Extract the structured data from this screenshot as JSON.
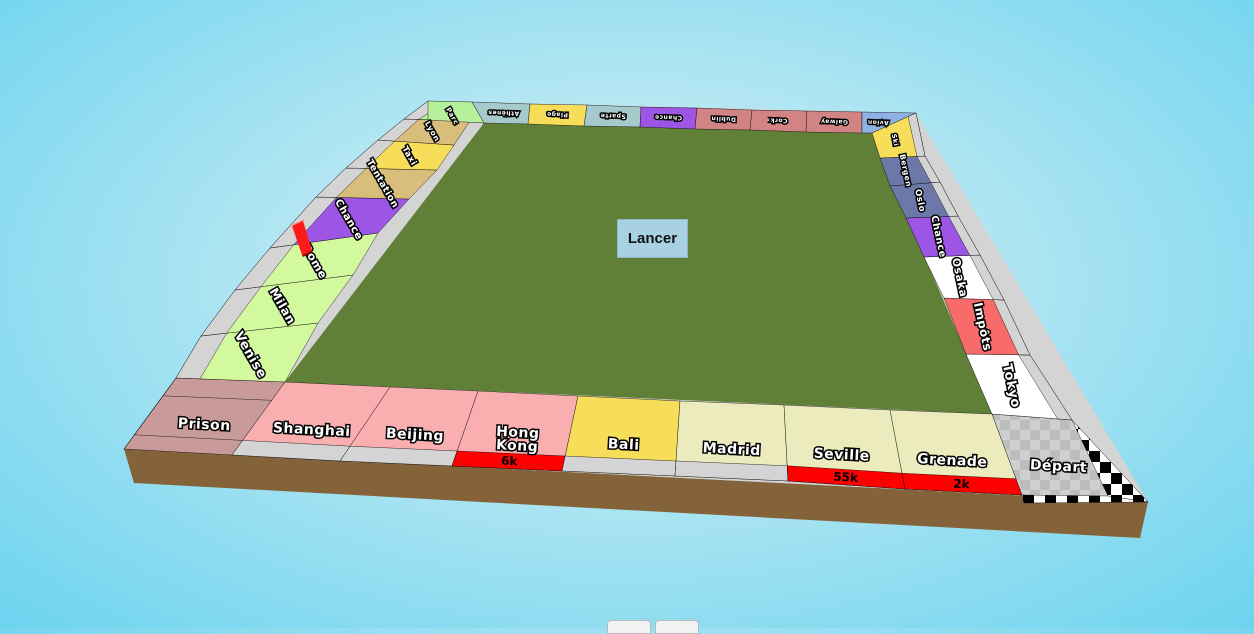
{
  "actions": {
    "roll_label": "Lancer"
  },
  "board": {
    "bottom_row": [
      {
        "name": "Prison",
        "color": "#c89a9a",
        "price": ""
      },
      {
        "name": "Shanghai",
        "color": "#f9afaf",
        "price": ""
      },
      {
        "name": "Beijing",
        "color": "#f9afaf",
        "price": ""
      },
      {
        "name": "Hong\nKong",
        "color": "#f9afaf",
        "price": "6k"
      },
      {
        "name": "Bali",
        "color": "#f6de5a",
        "price": ""
      },
      {
        "name": "Madrid",
        "color": "#ecebbd",
        "price": ""
      },
      {
        "name": "Seville",
        "color": "#ecebbd",
        "price": "55k"
      },
      {
        "name": "Grenade",
        "color": "#ecebbd",
        "price": "2k"
      },
      {
        "name": "Départ",
        "color": "#d0d0d0",
        "price": ""
      }
    ],
    "left_column": [
      {
        "name": "Venise",
        "color": "#d3f99f"
      },
      {
        "name": "Milan",
        "color": "#d3f99f"
      },
      {
        "name": "Rome",
        "color": "#d3f99f"
      },
      {
        "name": "Chance",
        "color": "#9d55e6"
      },
      {
        "name": "Tentation",
        "color": "#d9bd7a"
      },
      {
        "name": "Taxi",
        "color": "#f6de5a"
      },
      {
        "name": "Lyon",
        "color": "#d9bd7a"
      },
      {
        "name": "Parc",
        "color": "#b7f09a"
      }
    ],
    "top_row": [
      {
        "name": "Athènes",
        "color": "#a6c9cb"
      },
      {
        "name": "Plage",
        "color": "#f6de5a"
      },
      {
        "name": "Sparte",
        "color": "#a6c9cb"
      },
      {
        "name": "Chance",
        "color": "#9d55e6"
      },
      {
        "name": "Dublin",
        "color": "#d28484"
      },
      {
        "name": "Cork",
        "color": "#d28484"
      },
      {
        "name": "Galway",
        "color": "#d28484"
      },
      {
        "name": "Avion",
        "color": "#8eb1e6"
      }
    ],
    "right_column": [
      {
        "name": "Tokyo",
        "color": "#ffffff"
      },
      {
        "name": "Impôts",
        "color": "#f76b6b"
      },
      {
        "name": "Osaka",
        "color": "#ffffff"
      },
      {
        "name": "Chance",
        "color": "#9d55e6"
      },
      {
        "name": "Oslo",
        "color": "#6c79a8"
      },
      {
        "name": "Bergen",
        "color": "#6c79a8"
      },
      {
        "name": "Ski",
        "color": "#f6de5a"
      }
    ],
    "center_color": "#607f37",
    "frame_color": "#d4d4d4",
    "side_color": "#85633a",
    "price_color": "#ff0000",
    "pawn_color": "#ff1a1a"
  }
}
